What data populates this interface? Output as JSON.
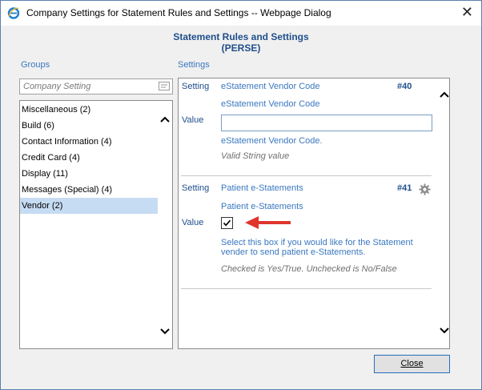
{
  "window": {
    "title": "Company Settings for Statement Rules and Settings -- Webpage Dialog",
    "icons": {
      "app": "ie-icon",
      "close": "close-icon"
    }
  },
  "header": {
    "line1": "Statement Rules and Settings",
    "line2": "(PERSE)"
  },
  "groups": {
    "label": "Groups",
    "search_placeholder": "Company Setting",
    "items": [
      "Miscellaneous (2)",
      "Build (6)",
      "Contact Information (4)",
      "Credit Card (4)",
      "Display (11)",
      "Messages (Special) (4)",
      "Vendor (2)"
    ],
    "selected": "Vendor (2)"
  },
  "settings": {
    "label": "Settings",
    "entries": [
      {
        "setting_label": "Setting",
        "name": "eStatement Vendor Code",
        "number": "#40",
        "subtitle": "eStatement Vendor Code",
        "value_label": "Value",
        "value": "",
        "description": "eStatement Vendor Code.",
        "note": "Valid String value"
      },
      {
        "setting_label": "Setting",
        "name": "Patient e-Statements",
        "number": "#41",
        "subtitle": "Patient e-Statements",
        "value_label": "Value",
        "checked": true,
        "description_line1": "Select this box if you would like for the Statement",
        "description_line2": "vender to send patient e-Statements.",
        "note": "Checked is Yes/True. Unchecked is No/False"
      }
    ]
  },
  "footer": {
    "close_label": "Close"
  },
  "colors": {
    "heading": "#1f4e8c",
    "link_blue": "#3a78c0",
    "selected_row": "#c6dcf3",
    "arrow": "#e0342d"
  }
}
